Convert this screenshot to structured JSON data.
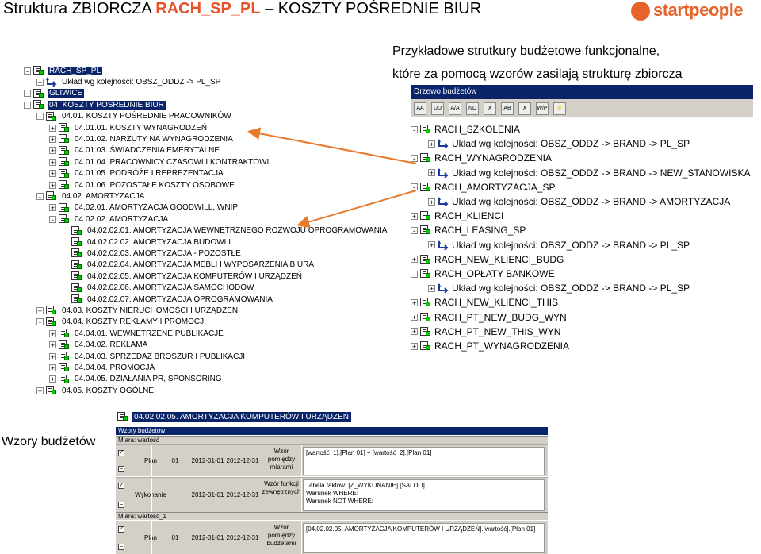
{
  "header": {
    "title_prefix": "Struktura ZBIORCZA",
    "title_accent": "RACH_SP_PL",
    "title_suffix": "– KOSZTY POŚREDNIE BIUR",
    "logo_text": "startpeople",
    "subtitle_line1": "Przykładowe strutkury budżetowe funkcjonalne,",
    "subtitle_line2": "które za pomocą wzorów zasilają strukturę zbiorcza"
  },
  "left_tree": [
    {
      "label": "RACH_SP_PL",
      "level": 0,
      "exp": "-",
      "selected": true
    },
    {
      "label": "Układ wg kolejności: OBSZ_ODDZ -> PL_SP",
      "level": 1,
      "exp": "+",
      "icon": "arrow"
    },
    {
      "label": "GLIWICE",
      "level": 0,
      "exp": "-",
      "selected": true
    },
    {
      "label": "04. KOSZTY POŚREDNIE BIUR",
      "level": 0,
      "exp": "-",
      "selected": true
    },
    {
      "label": "04.01. KOSZTY POŚREDNIE PRACOWNIKÓW",
      "level": 1,
      "exp": "-"
    },
    {
      "label": "04.01.01. KOSZTY WYNAGRODZEŃ",
      "level": 2,
      "exp": "+"
    },
    {
      "label": "04.01.02. NARZUTY NA WYNAGRODZENIA",
      "level": 2,
      "exp": "+"
    },
    {
      "label": "04.01.03. ŚWIADCZENIA EMERYTALNE",
      "level": 2,
      "exp": "+"
    },
    {
      "label": "04.01.04. PRACOWNICY CZASOWI I KONTRAKTOWI",
      "level": 2,
      "exp": "+"
    },
    {
      "label": "04.01.05. PODRÓŻE I REPREZENTACJA",
      "level": 2,
      "exp": "+"
    },
    {
      "label": "04.01.06. POZOSTAŁE KOSZTY OSOBOWE",
      "level": 2,
      "exp": "+"
    },
    {
      "label": "04.02. AMORTYZACJA",
      "level": 1,
      "exp": "-"
    },
    {
      "label": "04.02.01. AMORTYZACJA GOODWILL, WNIP",
      "level": 2,
      "exp": "+"
    },
    {
      "label": "04.02.02. AMORTYZACJA",
      "level": 2,
      "exp": "-"
    },
    {
      "label": "04.02.02.01. AMORTYZACJA WEWNĘTRZNEGO ROZWOJU OPROGRAMOWANIA",
      "level": 3,
      "exp": ""
    },
    {
      "label": "04.02.02.02. AMORTYZACJA BUDOWLI",
      "level": 3,
      "exp": ""
    },
    {
      "label": "04.02.02.03. AMORTYZACJA - POZOSTŁE",
      "level": 3,
      "exp": ""
    },
    {
      "label": "04.02.02.04. AMORTYZACJA MEBLI I WYPOSARZENIA BIURA",
      "level": 3,
      "exp": ""
    },
    {
      "label": "04.02.02.05. AMORTYZACJA KOMPUTERÓW I URZĄDZEŃ",
      "level": 3,
      "exp": ""
    },
    {
      "label": "04.02.02.06. AMORTYZACJA SAMOCHODÓW",
      "level": 3,
      "exp": ""
    },
    {
      "label": "04.02.02.07. AMORTYZACJA OPROGRAMOWANIA",
      "level": 3,
      "exp": ""
    },
    {
      "label": "04.03. KOSZTY NIERUCHOMOŚCI I URZĄDZEŃ",
      "level": 1,
      "exp": "+"
    },
    {
      "label": "04.04. KOSZTY  REKLAMY I PROMOCJI",
      "level": 1,
      "exp": "-"
    },
    {
      "label": "04.04.01. WEWNĘTRZENE PUBLIKACJE",
      "level": 2,
      "exp": "+"
    },
    {
      "label": "04.04.02. REKLAMA",
      "level": 2,
      "exp": "+"
    },
    {
      "label": "04.04.03. SPRZEDAŻ BROSZUR I PUBLIKACJI",
      "level": 2,
      "exp": "+"
    },
    {
      "label": "04.04.04. PROMOCJA",
      "level": 2,
      "exp": "+"
    },
    {
      "label": "04.04.05. DZIAŁANIA PR, SPONSORING",
      "level": 2,
      "exp": "+"
    },
    {
      "label": "04.05. KOSZTY OGÓLNE",
      "level": 1,
      "exp": "+"
    }
  ],
  "right_panel": {
    "title": "Drzewo budżetów",
    "toolbar": [
      "AA",
      "UU",
      "A/A",
      "ND",
      "X",
      "AB",
      "X",
      "W/P",
      "⚡"
    ]
  },
  "right_tree": [
    {
      "label": "RACH_SZKOLENIA",
      "level": 0,
      "exp": "-"
    },
    {
      "label": "Układ wg kolejności: OBSZ_ODDZ -> BRAND -> PL_SP",
      "level": 1,
      "exp": "+",
      "icon": "arrow"
    },
    {
      "label": "RACH_WYNAGRODZENIA",
      "level": 0,
      "exp": "-"
    },
    {
      "label": "Układ wg kolejności: OBSZ_ODDZ -> BRAND -> NEW_STANOWISKA",
      "level": 1,
      "exp": "+",
      "icon": "arrow"
    },
    {
      "label": "RACH_AMORTYZACJA_SP",
      "level": 0,
      "exp": "-"
    },
    {
      "label": "Układ wg kolejności: OBSZ_ODDZ -> BRAND -> AMORTYZACJA",
      "level": 1,
      "exp": "+",
      "icon": "arrow"
    },
    {
      "label": "RACH_KLIENCI",
      "level": 0,
      "exp": "+"
    },
    {
      "label": "RACH_LEASING_SP",
      "level": 0,
      "exp": "-"
    },
    {
      "label": "Układ wg kolejności: OBSZ_ODDZ -> BRAND -> PL_SP",
      "level": 1,
      "exp": "+",
      "icon": "arrow"
    },
    {
      "label": "RACH_NEW_KLIENCI_BUDG",
      "level": 0,
      "exp": "+"
    },
    {
      "label": "RACH_OPŁATY BANKOWE",
      "level": 0,
      "exp": "-"
    },
    {
      "label": "Układ wg kolejności: OBSZ_ODDZ -> BRAND -> PL_SP",
      "level": 1,
      "exp": "+",
      "icon": "arrow"
    },
    {
      "label": "RACH_NEW_KLIENCI_THIS",
      "level": 0,
      "exp": "+"
    },
    {
      "label": "RACH_PT_NEW_BUDG_WYN",
      "level": 0,
      "exp": "+"
    },
    {
      "label": "RACH_PT_NEW_THIS_WYN",
      "level": 0,
      "exp": "+"
    },
    {
      "label": "RACH_PT_WYNAGRODZENIA",
      "level": 0,
      "exp": "+"
    }
  ],
  "bottom": {
    "side_label": "Wzory budżetów",
    "selected_node": "04.02.02.05. AMORTYZACJA KOMPUTERÓW I URZĄDZEŃ",
    "grid_title": "Wzory budżetów",
    "measure1": "Miara: wartość",
    "measure2": "Miara: wartość_1",
    "rows": [
      {
        "name": "Plan",
        "version": "01",
        "from": "2012-01-01",
        "to": "2012-12-31",
        "type": "Wzór\npomiędzy\nmiarami",
        "formula": "[wartość_1].[Plan 01] + [wartość_2].[Plan 01]"
      },
      {
        "name": "Wykonanie",
        "version": "",
        "from": "2012-01-01",
        "to": "2012-12-31",
        "type": "Wzór funkcji\nzewnętrznych",
        "formula": "Tabela faktów: [Z_WYKONANIE].[SALDO]\nWarunek WHERE:\nWarunek NOT WHERE:"
      },
      {
        "name": "Plan",
        "version": "01",
        "from": "2012-01-01",
        "to": "2012-12-31",
        "type": "Wzór\npomiędzy\nbudżetami",
        "formula": "[04.02.02.05. AMORTYZACJA KOMPUTERÓW I URZĄDZEŃ].[wartość].[Plan 01]"
      }
    ]
  },
  "colors": {
    "accent": "#e8512a",
    "selection": "#0a246a",
    "arrow": "#e87a2a"
  }
}
